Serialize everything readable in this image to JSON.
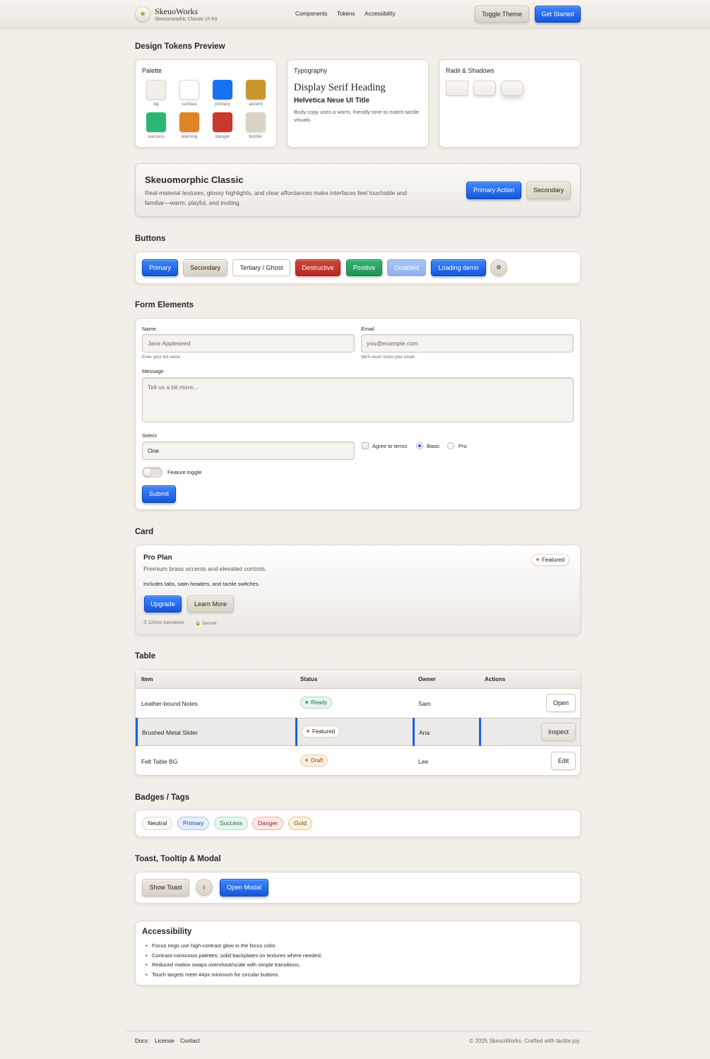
{
  "header": {
    "brand_icon": "★",
    "brand": "SkeuoWorks",
    "brand_sub": "Skeuomorphic Classic UI Kit",
    "nav": [
      "Components",
      "Tokens",
      "Accessibility"
    ],
    "toggle_theme": "Toggle Theme",
    "get_started": "Get Started"
  },
  "tokens": {
    "title": "Design Tokens Preview",
    "palette_label": "Palette",
    "swatches": [
      {
        "name": "bg",
        "color": "#f2efe9"
      },
      {
        "name": "surface",
        "color": "#ffffff"
      },
      {
        "name": "primary",
        "color": "#1672f3"
      },
      {
        "name": "accent",
        "color": "#c8952e"
      },
      {
        "name": "success",
        "color": "#2bb673"
      },
      {
        "name": "warning",
        "color": "#de8526"
      },
      {
        "name": "danger",
        "color": "#c7392c"
      },
      {
        "name": "border",
        "color": "#dbd3c7"
      }
    ],
    "typography_label": "Typography",
    "serif_heading": "Display Serif Heading",
    "ui_title": "Helvetica Neue UI Title",
    "body_copy": "Body copy uses a warm, friendly tone to match tactile visuals.",
    "radii_label": "Radii & Shadows"
  },
  "hero": {
    "title": "Skeuomorphic Classic",
    "description": "Real-material textures, glossy highlights, and clear affordances make interfaces feel touchable and familiar—warm, playful, and inviting.",
    "primary_action": "Primary Action",
    "secondary": "Secondary"
  },
  "buttons": {
    "title": "Buttons",
    "primary": "Primary",
    "secondary": "Secondary",
    "tertiary": "Tertiary / Ghost",
    "destructive": "Destructive",
    "positive": "Positive",
    "disabled": "Disabled",
    "loading": "Loading demo",
    "gear": "⚙"
  },
  "form": {
    "title": "Form Elements",
    "name_label": "Name",
    "name_placeholder": "Jane Appleseed",
    "name_hint": "Enter your full name.",
    "email_label": "Email",
    "email_placeholder": "you@example.com",
    "email_hint": "We'll never share your email.",
    "message_label": "Message",
    "message_placeholder": "Tell us a bit more...",
    "select_label": "Select",
    "select_value": "One",
    "agree": "Agree to terms",
    "basic": "Basic",
    "pro": "Pro",
    "toggle": "Feature toggle",
    "submit": "Submit"
  },
  "card": {
    "title": "Card",
    "plan": "Pro Plan",
    "subtitle": "Premium brass accents and elevated controls.",
    "detail": "Includes tabs, satin headers, and tactile switches.",
    "badge": "Featured",
    "upgrade": "Upgrade",
    "learn_more": "Learn More",
    "meta_timing": "⏱ 220ms transitions",
    "meta_secure": "🔒 Secure"
  },
  "table": {
    "title": "Table",
    "headers": [
      "Item",
      "Status",
      "Owner",
      "Actions"
    ],
    "rows": [
      {
        "item": "Leather-bound Notes",
        "status": "Ready",
        "owner": "Sam",
        "action": "Open"
      },
      {
        "item": "Brushed Metal Slider",
        "status": "Featured",
        "owner": "Ana",
        "action": "Inspect"
      },
      {
        "item": "Felt Table BG",
        "status": "Draft",
        "owner": "Lee",
        "action": "Edit"
      }
    ]
  },
  "badges": {
    "title": "Badges / Tags",
    "items": [
      "Neutral",
      "Primary",
      "Success",
      "Danger",
      "Gold"
    ]
  },
  "overlay": {
    "title": "Toast, Tooltip & Modal",
    "show_toast": "Show Toast",
    "info": "i",
    "open_modal": "Open Modal"
  },
  "accessibility": {
    "title": "Accessibility",
    "items": [
      "Focus rings use high-contrast glow in the focus color.",
      "Contrast-conscious palettes; solid backplates on textures where needed.",
      "Reduced motion swaps overshoot/scale with simple transitions.",
      "Touch targets meet 44px minimum for circular buttons."
    ]
  },
  "footer": {
    "links": [
      "Docs",
      "License",
      "Contact"
    ],
    "copyright": "© 2025 SkeuoWorks. Crafted with tactile joy."
  }
}
